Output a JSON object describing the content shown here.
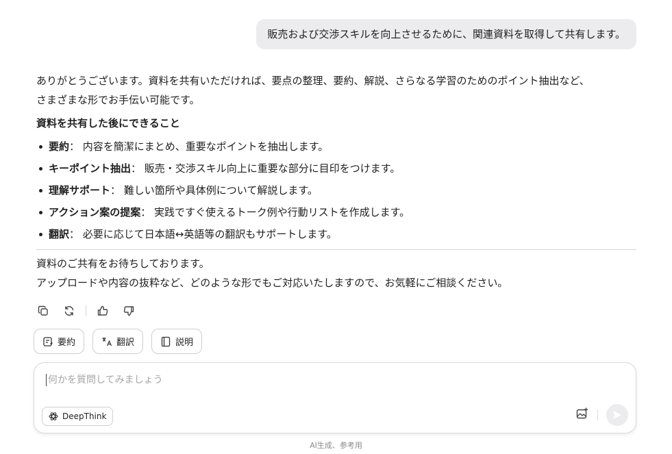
{
  "user_message": "販売および交渉スキルを向上させるために、関連資料を取得して共有します。",
  "assistant": {
    "intro_line1": "ありがとうございます。資料を共有いただければ、要点の整理、要約、解説、さらなる学習のためのポイント抽出など、",
    "intro_line2": "さまざまな形でお手伝い可能です。",
    "heading": "資料を共有した後にできること",
    "bullets": [
      {
        "term": "要約",
        "desc": "： 内容を簡潔にまとめ、重要なポイントを抽出します。"
      },
      {
        "term": "キーポイント抽出",
        "desc": "： 販売・交渉スキル向上に重要な部分に目印をつけます。"
      },
      {
        "term": "理解サポート",
        "desc": "： 難しい箇所や具体例について解説します。"
      },
      {
        "term": "アクション案の提案",
        "desc": "： 実践ですぐ使えるトーク例や行動リストを作成します。"
      },
      {
        "term": "翻訳",
        "desc": "： 必要に応じて日本語↔英語等の翻訳もサポートします。"
      }
    ],
    "closing_line1": "資料のご共有をお待ちしております。",
    "closing_line2": "アップロードや内容の抜粋など、どのような形でもご対応いたしますので、お気軽にご相談ください。"
  },
  "message_actions": {
    "icons": [
      "copy-icon",
      "regenerate-icon",
      "thumbs-up-icon",
      "thumbs-down-icon"
    ]
  },
  "chips": {
    "summary_label": "要約",
    "translate_label": "翻訳",
    "explain_label": "説明"
  },
  "composer": {
    "placeholder": "何かを質問してみましょう",
    "deepthink_label": "DeepThink"
  },
  "footer": {
    "note": "AI生成、参考用"
  },
  "colors": {
    "bubble_bg": "#ececee",
    "text": "#1f1f1f",
    "muted": "#8a8a8a",
    "border": "#cfcfcf"
  }
}
